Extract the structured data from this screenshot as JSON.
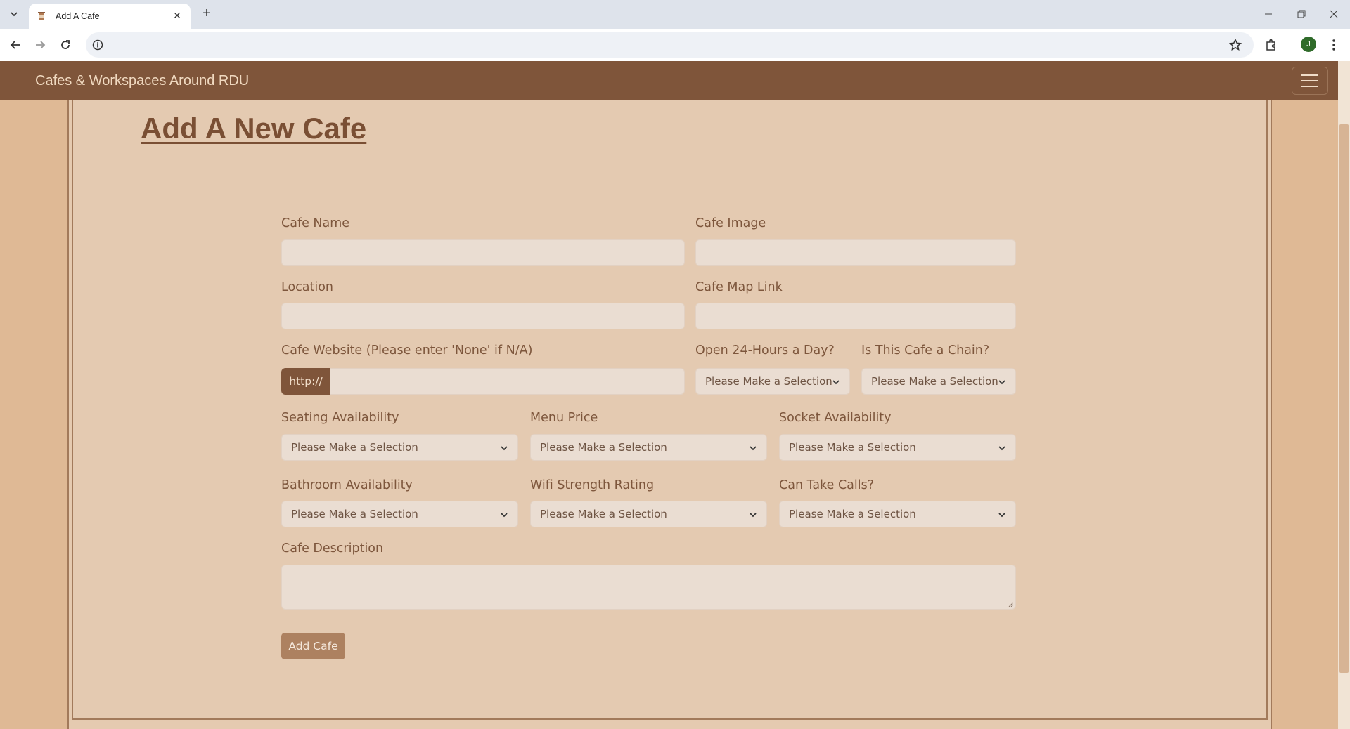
{
  "browser": {
    "tab_title": "Add A Cafe",
    "new_tab": "+",
    "avatar_initial": "J"
  },
  "navbar": {
    "brand": "Cafes & Workspaces Around RDU"
  },
  "page": {
    "heading": "Add A New Cafe"
  },
  "form": {
    "cafe_name_label": "Cafe Name",
    "cafe_image_label": "Cafe Image",
    "location_label": "Location",
    "map_link_label": "Cafe Map Link",
    "website_label": "Cafe Website (Please enter 'None' if N/A)",
    "website_prefix": "http://",
    "open24_label": "Open 24-Hours a Day?",
    "chain_label": "Is This Cafe a Chain?",
    "seating_label": "Seating Availability",
    "menu_price_label": "Menu Price",
    "socket_label": "Socket Availability",
    "bathroom_label": "Bathroom Availability",
    "wifi_label": "Wifi Strength Rating",
    "calls_label": "Can Take Calls?",
    "description_label": "Cafe Description",
    "select_placeholder": "Please Make a Selection",
    "submit_label": "Add Cafe"
  },
  "colors": {
    "navbar": "#7f553a",
    "page_bg": "#dfb995",
    "form_bg": "#e4cab1",
    "heading": "#7a4f34",
    "submit_button": "#ad8160"
  }
}
